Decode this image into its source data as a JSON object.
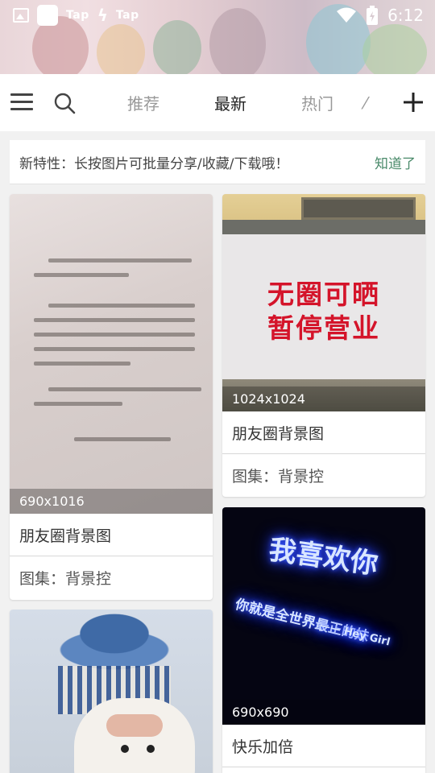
{
  "status_bar": {
    "tap_label_1": "Tap",
    "tap_label_2": "Tap",
    "time": "6:12"
  },
  "nav": {
    "tabs": [
      {
        "label": "推荐",
        "active": false
      },
      {
        "label": "最新",
        "active": true
      },
      {
        "label": "热门",
        "active": false
      }
    ],
    "icons": [
      "menu-icon",
      "search-icon",
      "plus-icon"
    ]
  },
  "notice": {
    "text": "新特性：长按图片可批量分享/收藏/下载哦！",
    "dismiss_label": "知道了"
  },
  "feed": {
    "left": [
      {
        "size": "690x1016",
        "title": "朋友圈背景图",
        "album": "图集：背景控"
      },
      {
        "size": "",
        "title": "",
        "album": ""
      }
    ],
    "right": [
      {
        "size": "1024x1024",
        "title": "朋友圈背景图",
        "album": "图集：背景控",
        "image_text_1": "无圈可晒",
        "image_text_2": "暂停营业"
      },
      {
        "size": "690x690",
        "title": "快乐加倍",
        "image_text_1": "我喜欢你",
        "image_text_2": "你就是全世界最正的妹",
        "image_text_3": "—— Hey Girl"
      }
    ]
  },
  "colors": {
    "accent_green": "#4a8a6a",
    "active_tab": "#222222",
    "inactive_tab": "#999999"
  }
}
